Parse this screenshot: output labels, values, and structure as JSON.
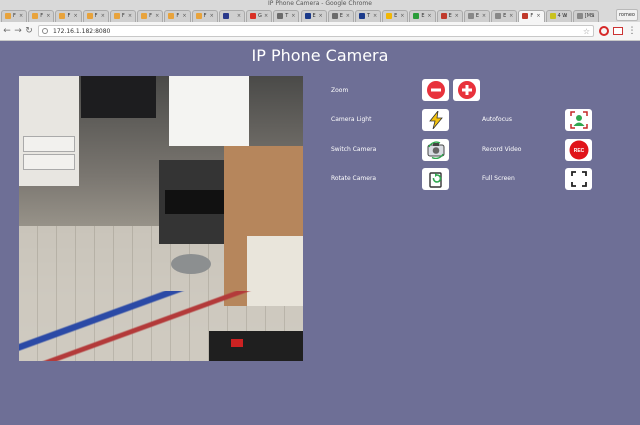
{
  "window": {
    "title": "IP Phone Camera - Google Chrome",
    "user_badge": "romeo"
  },
  "tabs": [
    {
      "label": "F",
      "color": "#e8a33c"
    },
    {
      "label": "F",
      "color": "#e8a33c"
    },
    {
      "label": "F",
      "color": "#e8a33c"
    },
    {
      "label": "F",
      "color": "#e8a33c"
    },
    {
      "label": "F",
      "color": "#e8a33c"
    },
    {
      "label": "F",
      "color": "#e8a33c"
    },
    {
      "label": "F",
      "color": "#e8a33c"
    },
    {
      "label": "F",
      "color": "#e8a33c"
    },
    {
      "label": "",
      "color": "#2a3a8c"
    },
    {
      "label": "G",
      "color": "#d93025"
    },
    {
      "label": "T",
      "color": "#6b6b6b"
    },
    {
      "label": "E",
      "color": "#1b3a8a"
    },
    {
      "label": "E",
      "color": "#6b6b6b"
    },
    {
      "label": "T",
      "color": "#1b3a8a"
    },
    {
      "label": "E",
      "color": "#f2b705"
    },
    {
      "label": "E",
      "color": "#2a9d3a"
    },
    {
      "label": "E",
      "color": "#c0392b"
    },
    {
      "label": "E",
      "color": "#888888"
    },
    {
      "label": "E",
      "color": "#888888"
    },
    {
      "label": "F",
      "color": "#c0392b"
    },
    {
      "label": "4 W",
      "color": "#c9c21e"
    },
    {
      "label": "[MS",
      "color": "#888888"
    }
  ],
  "address_bar": {
    "url": "172.16.1.182:8080"
  },
  "page": {
    "title": "IP Phone Camera"
  },
  "controls": {
    "zoom": "Zoom",
    "camera_light": "Camera Light",
    "autofocus": "Autofocus",
    "switch_camera": "Switch Camera",
    "record_video": "Record Video",
    "rotate_camera": "Rotate Camera",
    "full_screen": "Full Screen",
    "rec_badge": "REC"
  },
  "colors": {
    "background": "#6e6f96",
    "zoom_red": "#e8323c",
    "light_yellow": "#f4c20d",
    "autofocus_green": "#2fa84f"
  }
}
